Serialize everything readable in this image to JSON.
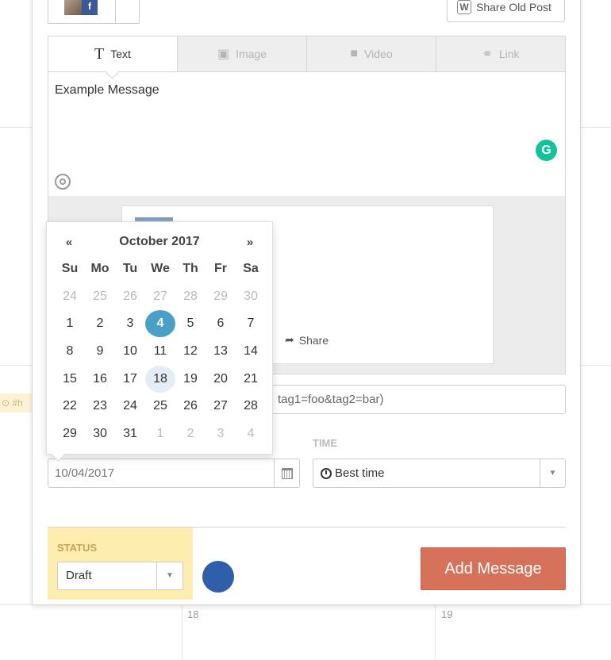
{
  "background": {
    "dates": [
      "18",
      "19"
    ],
    "event_text": "⊙ #h"
  },
  "toolbar": {
    "share_old_post": "Share Old Post"
  },
  "tabs": [
    {
      "label": "Text",
      "icon": "text-icon",
      "active": true
    },
    {
      "label": "Image",
      "icon": "image-icon",
      "active": false
    },
    {
      "label": "Video",
      "icon": "video-icon",
      "active": false
    },
    {
      "label": "Link",
      "icon": "link-icon",
      "active": false
    }
  ],
  "editor": {
    "message": "Example Message",
    "grammarly_letter": "G"
  },
  "preview": {
    "share_label": "Share"
  },
  "utm": {
    "value": "tag1=foo&tag2=bar)"
  },
  "schedule": {
    "time_label": "TIME",
    "date_value": "10/04/2017",
    "time_value": "Best time"
  },
  "status": {
    "label": "STATUS",
    "value": "Draft"
  },
  "actions": {
    "add_message": "Add Message"
  },
  "datepicker": {
    "prev": "«",
    "next": "»",
    "title": "October 2017",
    "weekdays": [
      "Su",
      "Mo",
      "Tu",
      "We",
      "Th",
      "Fr",
      "Sa"
    ],
    "weeks": [
      [
        "24",
        "25",
        "26",
        "27",
        "28",
        "29",
        "30"
      ],
      [
        "1",
        "2",
        "3",
        "4",
        "5",
        "6",
        "7"
      ],
      [
        "8",
        "9",
        "10",
        "11",
        "12",
        "13",
        "14"
      ],
      [
        "15",
        "16",
        "17",
        "18",
        "19",
        "20",
        "21"
      ],
      [
        "22",
        "23",
        "24",
        "25",
        "26",
        "27",
        "28"
      ],
      [
        "29",
        "30",
        "31",
        "1",
        "2",
        "3",
        "4"
      ]
    ],
    "selected": "4",
    "today": "18"
  },
  "colors": {
    "accent_button": "#d6725a",
    "status_bg": "#fdeeb0",
    "selected_day": "#4a9fc7",
    "grammarly": "#15c39a",
    "facebook": "#3b5998"
  }
}
